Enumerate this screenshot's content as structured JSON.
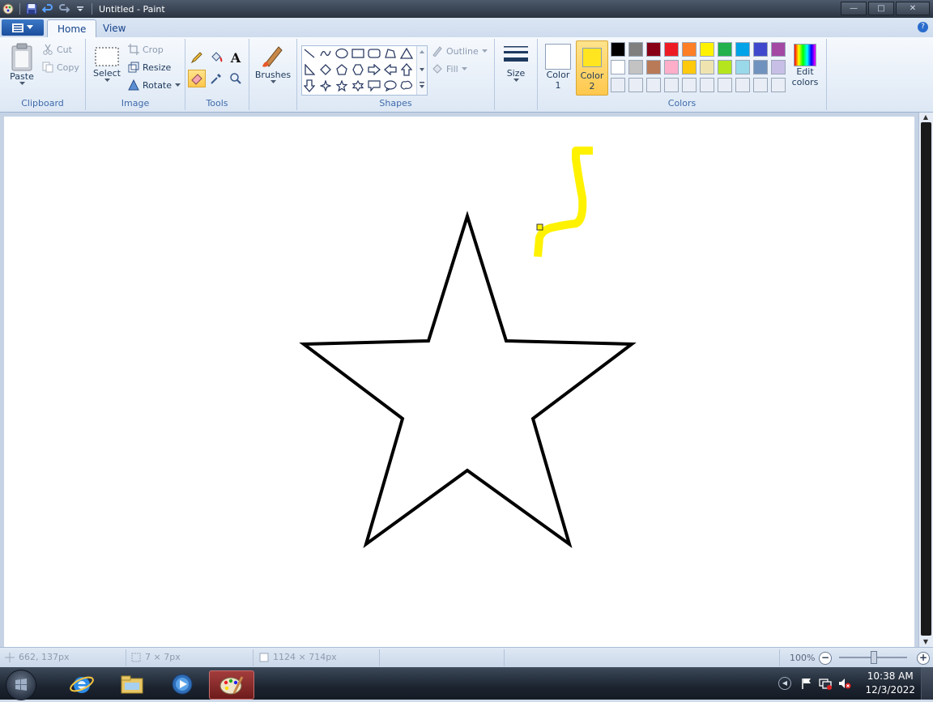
{
  "window": {
    "title": "Untitled - Paint",
    "controls": {
      "minimize": "—",
      "maximize": "□",
      "close": "✕"
    }
  },
  "ribbon_tabs": [
    {
      "label": "Home",
      "active": true
    },
    {
      "label": "View",
      "active": false
    }
  ],
  "clipboard": {
    "paste": "Paste",
    "cut": "Cut",
    "copy": "Copy",
    "group_label": "Clipboard"
  },
  "image": {
    "select": "Select",
    "crop": "Crop",
    "resize": "Resize",
    "rotate": "Rotate",
    "group_label": "Image"
  },
  "tools": {
    "group_label": "Tools"
  },
  "brushes": {
    "label": "Brushes"
  },
  "shapes": {
    "outline": "Outline",
    "fill": "Fill",
    "group_label": "Shapes"
  },
  "size": {
    "label": "Size"
  },
  "colors": {
    "color1_label": "Color\n1",
    "color1_line1": "Color",
    "color1_line2": "1",
    "color2_line1": "Color",
    "color2_line2": "2",
    "color1_value": "#ffffff",
    "color2_value": "#ffe51f",
    "edit_line1": "Edit",
    "edit_line2": "colors",
    "group_label": "Colors",
    "palette_row1": [
      "#000000",
      "#7f7f7f",
      "#880015",
      "#ed1c24",
      "#ff7f27",
      "#fff200",
      "#22b14c",
      "#00a2e8",
      "#3f48cc",
      "#a349a4"
    ],
    "palette_row2": [
      "#ffffff",
      "#c3c3c3",
      "#b97a57",
      "#ffaec9",
      "#ffc90e",
      "#efe4b0",
      "#b5e61d",
      "#99d9ea",
      "#7092be",
      "#c8bfe7"
    ],
    "palette_row3": [
      "#e9eef6",
      "#e9eef6",
      "#e9eef6",
      "#e9eef6",
      "#e9eef6",
      "#e9eef6",
      "#e9eef6",
      "#e9eef6",
      "#e9eef6",
      "#e9eef6"
    ]
  },
  "statusbar": {
    "cursor_pos": "662, 137px",
    "selection_size": "7 × 7px",
    "canvas_size": "1124 × 714px",
    "zoom": "100%"
  },
  "taskbar": {
    "time": "10:38 AM",
    "date": "12/3/2022"
  }
}
